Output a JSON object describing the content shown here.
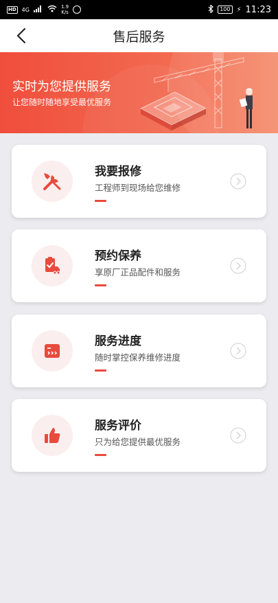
{
  "status_bar": {
    "hd": "HD",
    "network": "4G",
    "speed_value": "1.9",
    "speed_unit": "K/s",
    "battery": "100",
    "time": "11:23"
  },
  "header": {
    "title": "售后服务"
  },
  "banner": {
    "title": "实时为您提供服务",
    "subtitle": "让您随时随地享受最优服务"
  },
  "services": [
    {
      "title": "我要报修",
      "desc": "工程师到现场给您维修",
      "icon": "wrench-screwdriver-icon"
    },
    {
      "title": "预约保养",
      "desc": "享原厂正品配件和服务",
      "icon": "clipboard-truck-icon"
    },
    {
      "title": "服务进度",
      "desc": "随时掌控保养维修进度",
      "icon": "progress-window-icon"
    },
    {
      "title": "服务评价",
      "desc": "只为给您提供最优服务",
      "icon": "thumbs-up-icon"
    }
  ],
  "colors": {
    "accent": "#e84a3d",
    "icon_bg": "#fbeeee",
    "page_bg": "#ececf0"
  }
}
